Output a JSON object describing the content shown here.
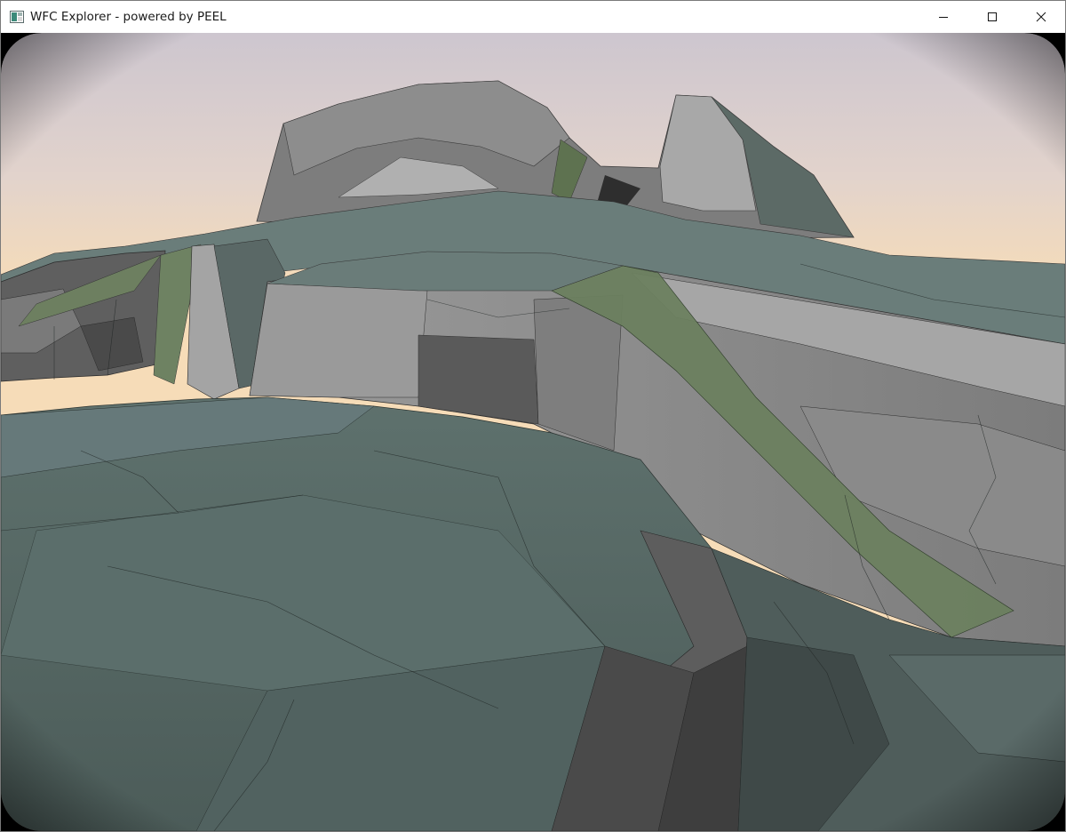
{
  "window": {
    "title": "WFC Explorer - powered by PEEL",
    "icon": "app-window-icon",
    "controls": [
      {
        "name": "minimize-button",
        "icon": "minimize-icon"
      },
      {
        "name": "maximize-button",
        "icon": "maximize-icon"
      },
      {
        "name": "close-button",
        "icon": "close-icon"
      }
    ]
  },
  "scene": {
    "description_type": "3d-render",
    "sky_top_color": "#cfc8cf",
    "sky_horizon_color": "#f6dcb8",
    "rock_colors": [
      "#5c6e6b",
      "#6e7c79",
      "#8a8a8a",
      "#a0a0a0",
      "#4f5152",
      "#6d7a62"
    ],
    "vignette": true
  }
}
